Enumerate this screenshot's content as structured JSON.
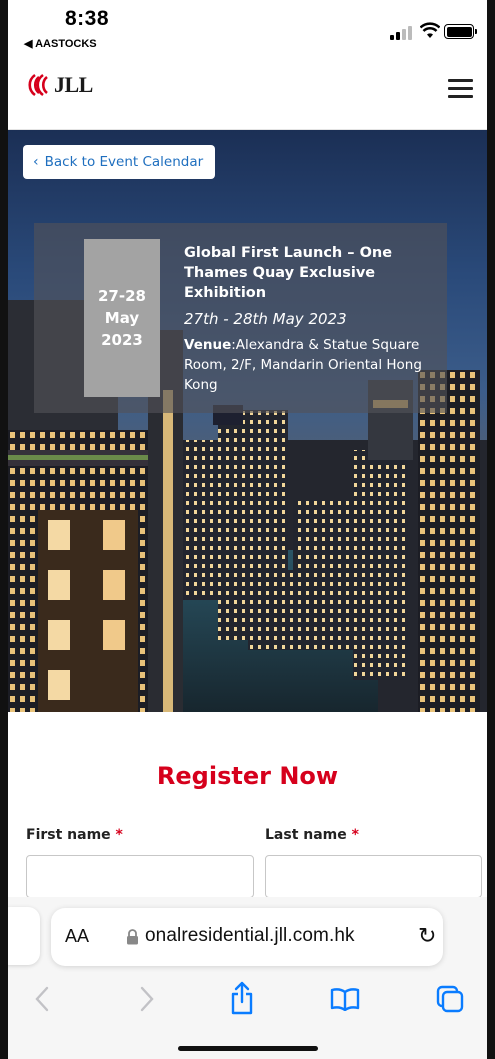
{
  "status_bar": {
    "time": "8:38",
    "back_app": "◀ AASTOCKS"
  },
  "header": {
    "logo_text": "JLL",
    "brand_color": "#d6001c"
  },
  "hero": {
    "back_button": "Back to Event Calendar",
    "date_box": {
      "line1": "27-28",
      "line2": "May",
      "line3": "2023"
    },
    "event_title": "Global First Launch – One Thames Quay Exclusive Exhibition",
    "event_dates": "27th - 28th May 2023",
    "venue_label": "Venue",
    "venue_text": ":Alexandra & Statue Square Room, 2/F, Mandarin Oriental Hong Kong"
  },
  "register": {
    "title": "Register Now",
    "first_name_label": "First name",
    "last_name_label": "Last name",
    "required_marker": "*",
    "first_name_value": "",
    "last_name_value": ""
  },
  "browser": {
    "aa_label": "AA",
    "url": "onalresidential.jll.com.hk",
    "icons": [
      "lock-icon",
      "reload-icon",
      "back-icon",
      "forward-icon",
      "share-icon",
      "bookmarks-icon",
      "tabs-icon"
    ],
    "accent_color": "#0a7cff"
  }
}
